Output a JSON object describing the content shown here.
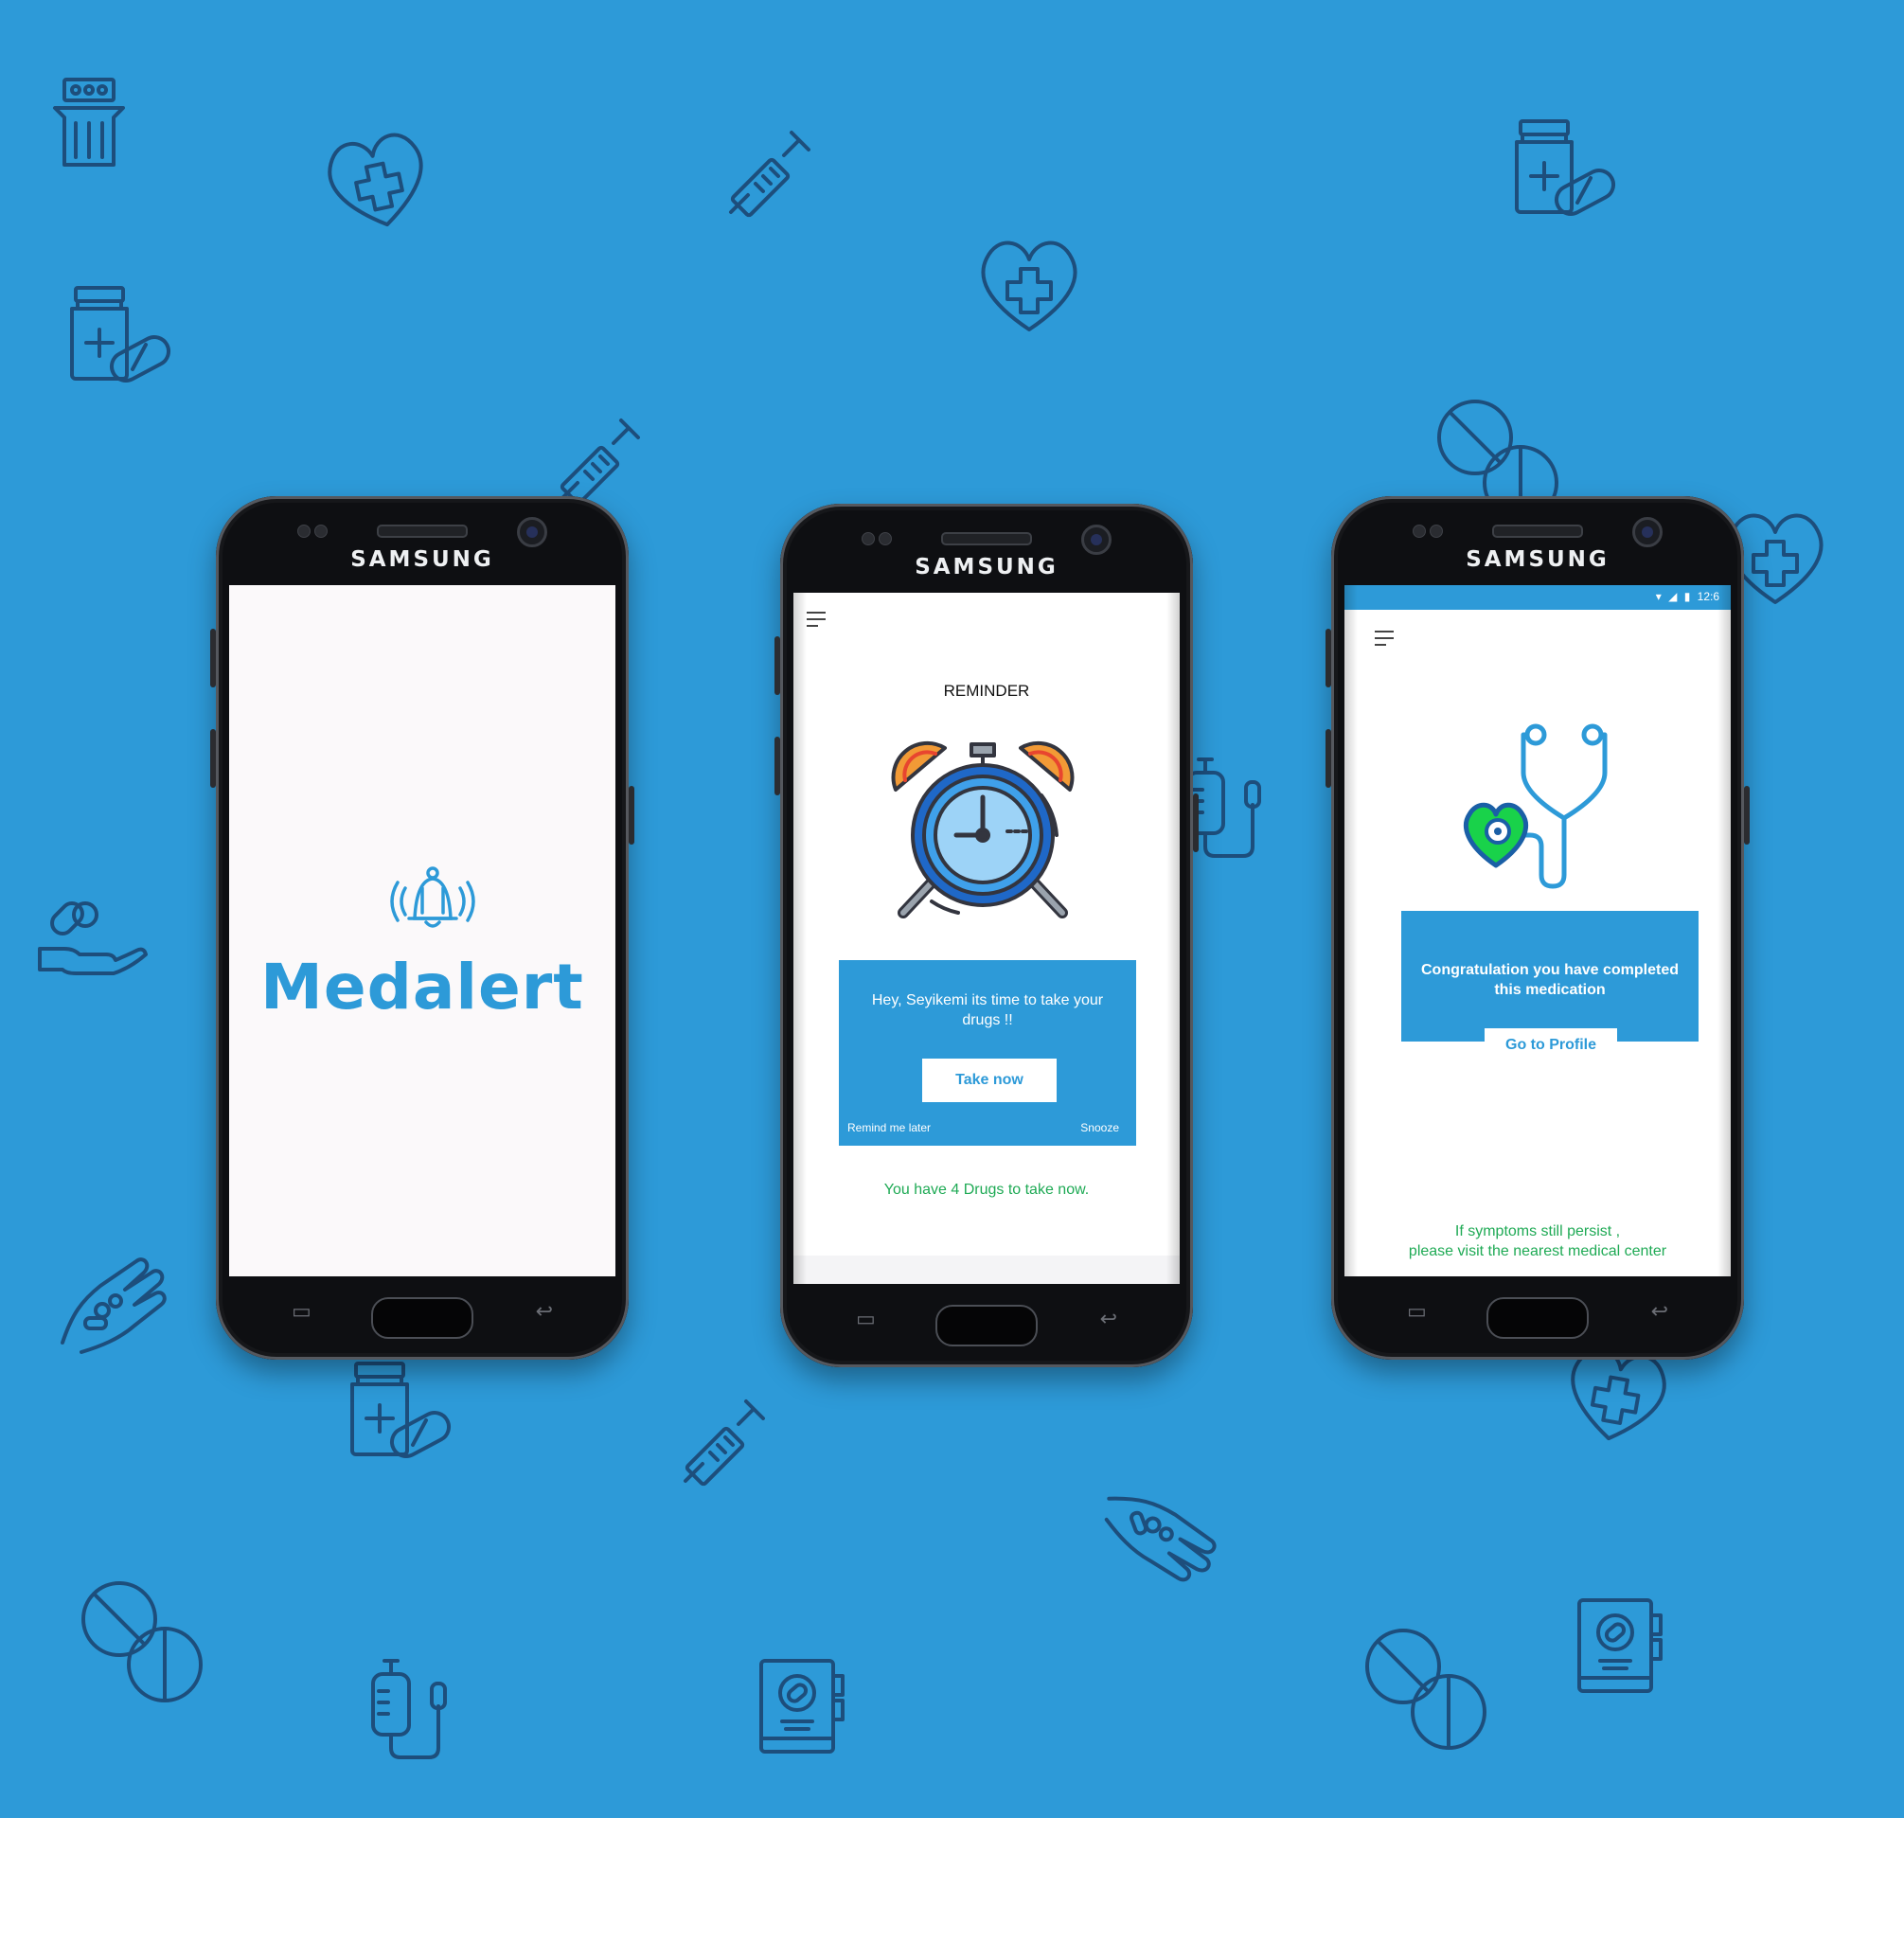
{
  "colors": {
    "background": "#2d9ad8",
    "icon_stroke": "#1d4e7c",
    "accent": "#2d9ad8",
    "success_text": "#1faa55",
    "heart_green": "#19d24a"
  },
  "background_icons": [
    "pill-bottle-icon",
    "heart-plus-icon",
    "syringe-icon",
    "heart-cross-icon",
    "no-pill-icon",
    "iv-bag-icon",
    "hand-pills-icon",
    "medical-book-icon",
    "pill-box-icon"
  ],
  "phones": {
    "splash": {
      "brand": "SAMSUNG",
      "app_name": "Medalert"
    },
    "reminder": {
      "brand": "SAMSUNG",
      "title": "REMINDER",
      "message": "Hey, Seyikemi its time to take your drugs !!",
      "take_now_label": "Take now",
      "remind_later_label": "Remind me later",
      "snooze_label": "Snooze",
      "footer_note": "You have 4 Drugs to take now."
    },
    "complete": {
      "brand": "SAMSUNG",
      "status_time": "12:6",
      "message": "Congratulation you have completed this medication",
      "profile_button_label": "Go to Profile",
      "footer_note_line1": "If symptoms still persist ,",
      "footer_note_line2": "please visit the nearest medical center"
    }
  }
}
